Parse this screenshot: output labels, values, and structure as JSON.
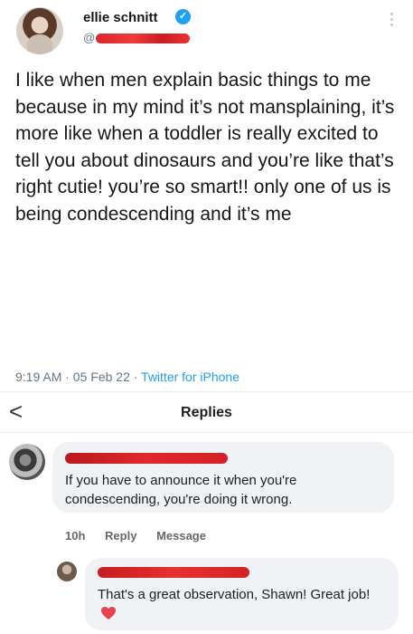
{
  "tweet": {
    "author_name": "ellie schnitt",
    "handle_prefix": "@",
    "text": "I like when men explain basic things to me because in my mind it’s not mansplaining, it’s more like when a toddler is really excited to tell you about dinosaurs and you’re like that’s right cutie! you’re so smart!! only one of us is being condescending and it’s me",
    "time_date": "9:19 AM · 05 Feb 22 · ",
    "source": "Twitter for iPhone"
  },
  "replies_header": {
    "back_glyph": "<",
    "title": "Replies"
  },
  "comments": [
    {
      "text": "If you have to announce it when you're condescending, you're doing it wrong.",
      "time": "10h",
      "reply_label": "Reply",
      "message_label": "Message"
    },
    {
      "text": "That's a great observation, Shawn! Great job!"
    }
  ],
  "colors": {
    "verified_blue": "#1da1f2",
    "redaction_red": "#e0282c",
    "bubble_gray": "#f0f2f5",
    "heart_red": "#e8424f"
  },
  "icons": [
    "verified-badge-icon",
    "more-options-icon",
    "back-chevron-icon",
    "heart-emoji-icon"
  ]
}
